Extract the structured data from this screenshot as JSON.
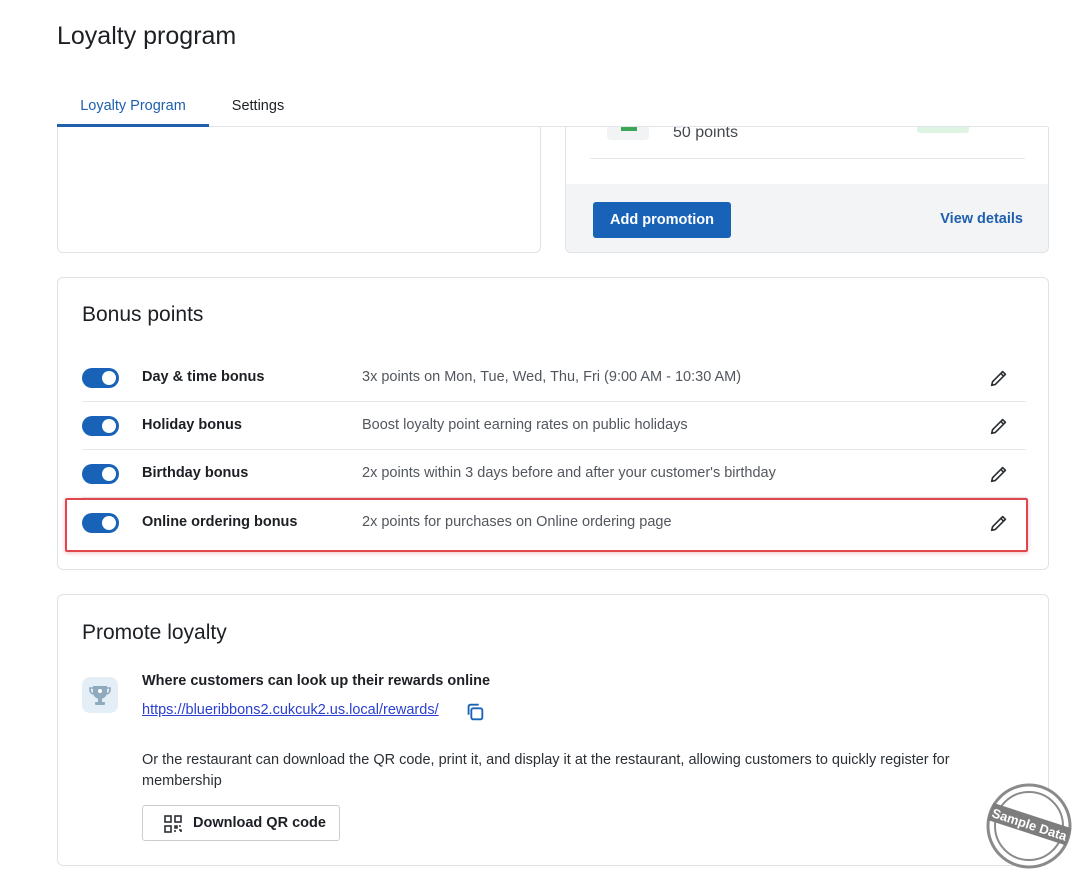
{
  "page": {
    "title": "Loyalty program"
  },
  "tabs": [
    {
      "label": "Loyalty Program",
      "active": true
    },
    {
      "label": "Settings",
      "active": false
    }
  ],
  "promotion": {
    "points_text": "50 points",
    "add_button": "Add promotion",
    "view_details": "View details"
  },
  "bonus": {
    "title": "Bonus points",
    "items": [
      {
        "name": "Day & time bonus",
        "description": "3x points on Mon, Tue, Wed, Thu, Fri (9:00 AM - 10:30 AM)",
        "enabled": true
      },
      {
        "name": "Holiday bonus",
        "description": "Boost loyalty point earning rates on public holidays",
        "enabled": true
      },
      {
        "name": "Birthday bonus",
        "description": "2x points within 3 days before and after your customer's birthday",
        "enabled": true
      },
      {
        "name": "Online ordering bonus",
        "description": "2x points for purchases on Online ordering page",
        "enabled": true
      }
    ]
  },
  "promote": {
    "title": "Promote loyalty",
    "lookup_title": "Where customers can look up their rewards online",
    "rewards_url": "https://blueribbons2.cukcuk2.us.local/rewards/",
    "qr_description": "Or the restaurant can download the QR code, print it, and display it at the restaurant, allowing customers to quickly register for membership",
    "qr_button": "Download QR code"
  },
  "watermark": {
    "text": "Sample Data"
  },
  "colors": {
    "primary": "#1863b8",
    "link": "#2a3fd0",
    "highlight": "#e0464c"
  },
  "icons": [
    "pencil-icon",
    "copy-icon",
    "qr-code-icon",
    "trophy-icon"
  ]
}
